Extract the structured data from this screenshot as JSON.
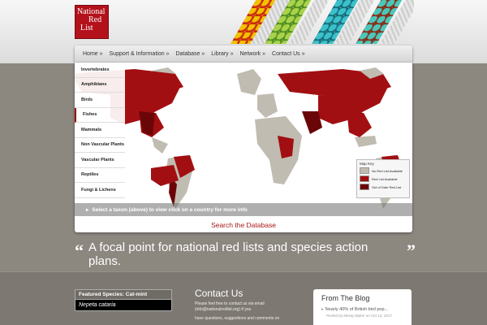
{
  "logo": {
    "line1": "National",
    "line2": "Red",
    "line3": "List"
  },
  "nav": [
    {
      "label": "Home »"
    },
    {
      "label": "Support & Information »"
    },
    {
      "label": "Database »"
    },
    {
      "label": "Library »"
    },
    {
      "label": "Network »"
    },
    {
      "label": "Contact Us »"
    }
  ],
  "sidebar": [
    {
      "label": "Invertebrates"
    },
    {
      "label": "Amphibians"
    },
    {
      "label": "Birds"
    },
    {
      "label": "Fishes"
    },
    {
      "label": "Mammals"
    },
    {
      "label": "Non Vascular Plants"
    },
    {
      "label": "Vascular Plants"
    },
    {
      "label": "Reptiles"
    },
    {
      "label": "Fungi & Lichens"
    }
  ],
  "map": {
    "instruction": "Select a taxon (above) to view                          click on a country for more info",
    "search_label": "Search the Database"
  },
  "map_key": {
    "title": "Map Key",
    "items": [
      {
        "label": "No Red List Available",
        "color": "#c0bcb1"
      },
      {
        "label": "Red List Available",
        "color": "#a20f12"
      },
      {
        "label": "Out of Date Red List",
        "color": "#6b0608"
      }
    ]
  },
  "tagline": {
    "open_quote": "“",
    "text": "A focal point for national red lists and species action plans.",
    "close_quote": "”"
  },
  "featured": {
    "heading": "Featured Species: Cat-mint",
    "species": "Nepeta cataria"
  },
  "contact": {
    "title": "Contact Us",
    "text1": "Please feel free to contact us via email (info@nationalredlist.org) if you",
    "text2": "have questions, suggestions and comments on"
  },
  "blog": {
    "title": "From The Blog",
    "item": "Nearly 40% of British bird pop...",
    "meta": "Posted by Mosey Baker on Oct 13, 2017"
  },
  "colors": {
    "accent": "#a61818",
    "gray_land": "#c0bcb1",
    "red_land": "#a20f12",
    "dark_red_land": "#6b0608"
  }
}
